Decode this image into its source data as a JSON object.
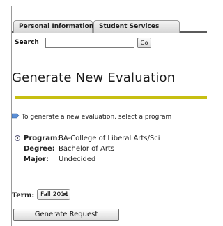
{
  "tabs": [
    {
      "label": "Personal Information",
      "active": false
    },
    {
      "label": "Student Services",
      "active": true
    }
  ],
  "search": {
    "label": "Search",
    "value": "",
    "go_label": "Go"
  },
  "page_title": "Generate New Evaluation",
  "info_text": "To generate a new evaluation, select a program",
  "program": {
    "selected": true,
    "program_label": "Program:",
    "program_value": "BA-College of Liberal Arts/Sci",
    "degree_label": "Degree:",
    "degree_value": "Bachelor of Arts",
    "major_label": "Major:",
    "major_value": "Undecided"
  },
  "term": {
    "label": "Term:",
    "selected": "Fall 2011"
  },
  "generate_button": "Generate Request",
  "colors": {
    "title_rule": "#c7bf12",
    "tab_border": "#9a9a9a"
  }
}
